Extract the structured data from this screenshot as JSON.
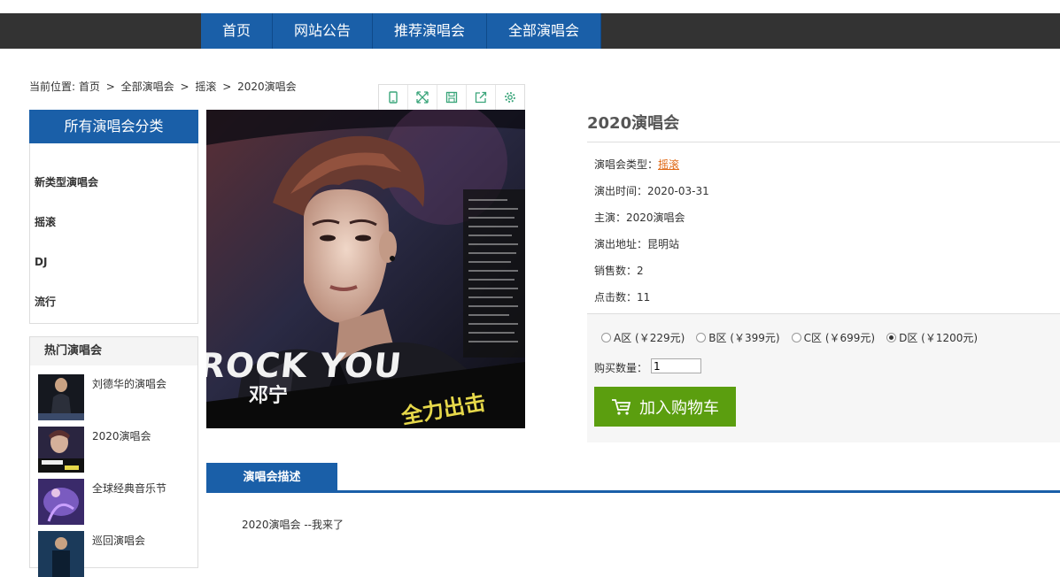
{
  "nav": {
    "items": [
      "首页",
      "网站公告",
      "推荐演唱会",
      "全部演唱会"
    ]
  },
  "breadcrumb": {
    "prefix": "当前位置:",
    "items": [
      "首页",
      "全部演唱会",
      "摇滚",
      "2020演唱会"
    ],
    "separator": ">"
  },
  "sidebar": {
    "category_title": "所有演唱会分类",
    "categories": [
      "新类型演唱会",
      "摇滚",
      "DJ",
      "流行"
    ],
    "hot_title": "热门演唱会",
    "hot_items": [
      "刘德华的演唱会",
      "2020演唱会",
      "全球经典音乐节",
      "巡回演唱会"
    ]
  },
  "toolbar": {
    "icons": [
      "mobile-icon",
      "fullscreen-icon",
      "save-icon",
      "share-icon",
      "settings-icon"
    ]
  },
  "poster": {
    "title_art": "ROCK YOU",
    "artist": "邓宁",
    "slogan": "全力出击"
  },
  "product": {
    "title": "2020演唱会",
    "type_label": "演唱会类型：",
    "type_value": "摇滚",
    "date": "演出时间：2020-03-31",
    "lead": "主演：2020演唱会",
    "venue": "演出地址：昆明站",
    "sales": "销售数：2",
    "clicks": "点击数：11"
  },
  "purchase": {
    "options": [
      "A区 (￥229元)",
      "B区 (￥399元)",
      "C区 (￥699元)",
      "D区 (￥1200元)"
    ],
    "selected": "D区 (￥1200元)",
    "qty_label": "购买数量：",
    "qty_value": "1",
    "cart_label": "加入购物车"
  },
  "description": {
    "tab_label": "演唱会描述",
    "text": "2020演唱会 --我来了"
  },
  "colors": {
    "primary": "#1a5fa8",
    "nav_bg": "#333333",
    "cart_green": "#5b9e0f",
    "link_orange": "#e06a16",
    "toolbar_icon": "#3aa57a"
  }
}
